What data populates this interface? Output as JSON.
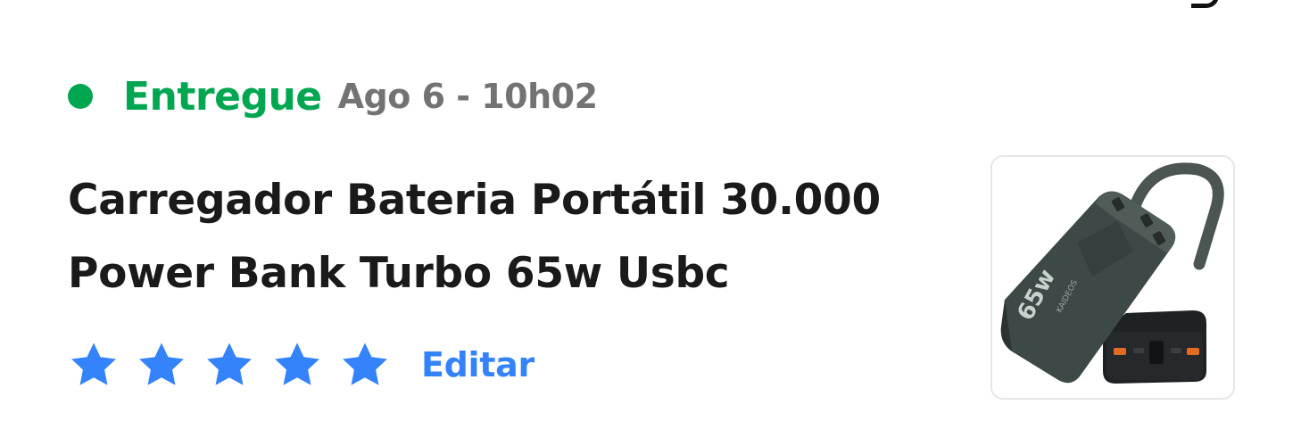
{
  "order": {
    "status": "Entregue",
    "date": "Ago 6 - 10h02",
    "status_color": "#00a650",
    "product_title": "Carregador Bateria Portátil 30.000 Power Bank Turbo 65w Usbc",
    "rating": {
      "value": 5,
      "max": 5,
      "star_color": "#3483fa",
      "edit_label": "Editar"
    },
    "image": {
      "alt": "power-bank-product-image",
      "device_text": "65w",
      "brand_text": "KAIDEOS"
    }
  }
}
